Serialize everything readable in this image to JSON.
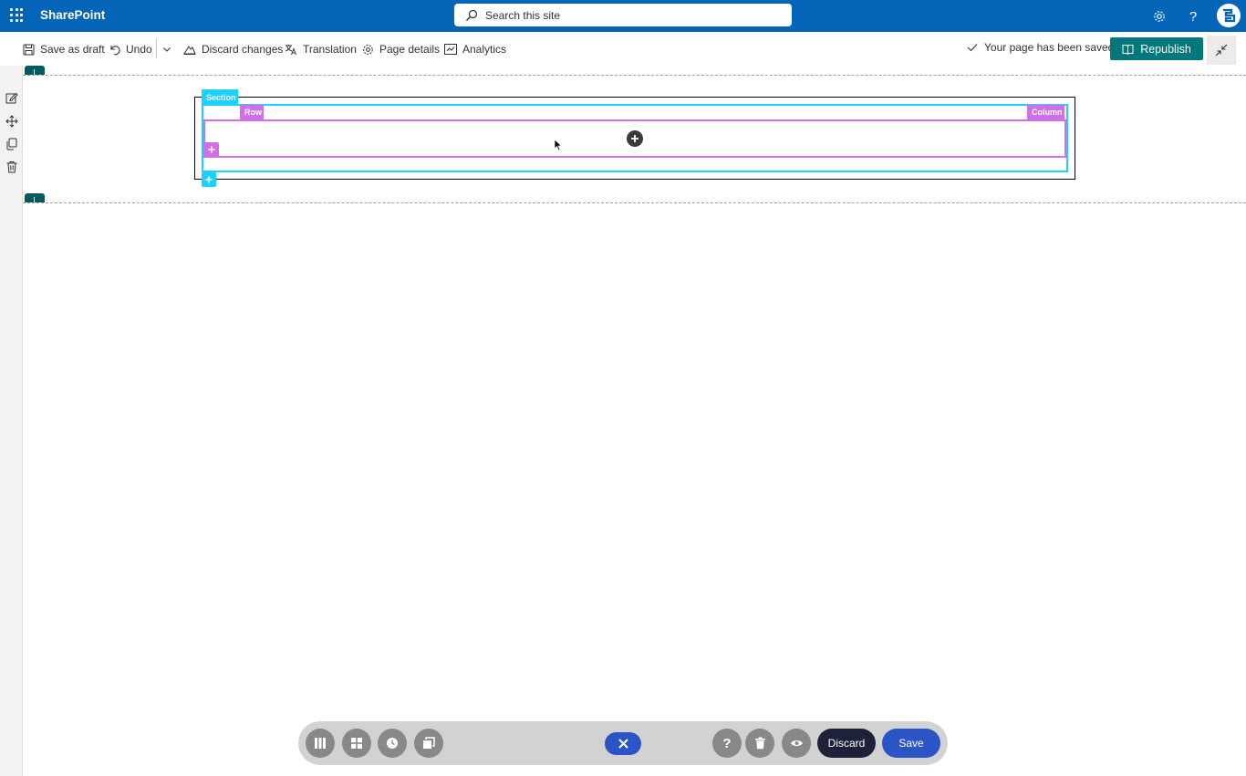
{
  "suite": {
    "app_name": "SharePoint",
    "search_placeholder": "Search this site",
    "help_glyph": "?"
  },
  "commands": {
    "save_draft": "Save as draft",
    "undo": "Undo",
    "discard_changes": "Discard changes",
    "translation": "Translation",
    "page_details": "Page details",
    "analytics": "Analytics"
  },
  "status": {
    "saved_message": "Your page has been saved",
    "republish": "Republish"
  },
  "layout_tags": {
    "section": "Section",
    "row": "Row",
    "column": "Column"
  },
  "bottom_toolbar": {
    "discard": "Discard",
    "save": "Save",
    "help_glyph": "?"
  },
  "colors": {
    "suite_blue": "#0364b8",
    "teal": "#03787c",
    "section_cyan": "#1ad1ff",
    "row_pink": "#d36ee8",
    "toolbar_blue": "#2b55c5",
    "toolbar_dark": "#1e2238"
  },
  "icons": [
    "app-launcher-icon",
    "search-icon",
    "settings-icon",
    "help-icon",
    "avatar-logo-icon",
    "save-icon",
    "undo-icon",
    "chevron-down-icon",
    "discard-icon",
    "translation-icon",
    "gear-icon",
    "analytics-icon",
    "checkmark-icon",
    "book-icon",
    "collapse-icon",
    "edit-icon",
    "move-icon",
    "duplicate-icon",
    "trash-icon",
    "plus-icon",
    "columns-icon",
    "grid-icon",
    "clock-icon",
    "copy-icon",
    "close-icon",
    "eye-icon"
  ]
}
